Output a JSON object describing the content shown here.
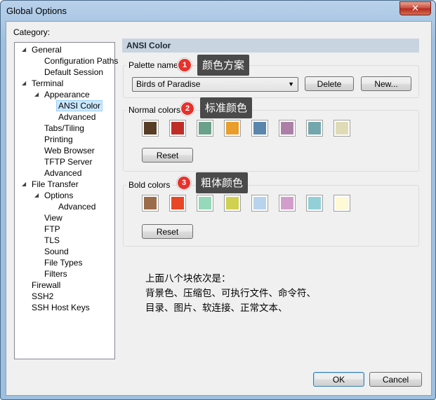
{
  "window": {
    "title": "Global Options",
    "close_glyph": "✕"
  },
  "category_label": "Category:",
  "tree": [
    {
      "label": "General",
      "expanded": true
    },
    {
      "label": "Configuration Paths"
    },
    {
      "label": "Default Session"
    },
    {
      "label": "Terminal",
      "expanded": true
    },
    {
      "label": "Appearance",
      "expanded": true
    },
    {
      "label": "ANSI Color",
      "selected": true
    },
    {
      "label": "Advanced"
    },
    {
      "label": "Tabs/Tiling"
    },
    {
      "label": "Printing"
    },
    {
      "label": "Web Browser"
    },
    {
      "label": "TFTP Server"
    },
    {
      "label": "Advanced"
    },
    {
      "label": "File Transfer",
      "expanded": true
    },
    {
      "label": "Options",
      "expanded": true
    },
    {
      "label": "Advanced"
    },
    {
      "label": "View"
    },
    {
      "label": "FTP"
    },
    {
      "label": "TLS"
    },
    {
      "label": "Sound"
    },
    {
      "label": "File Types"
    },
    {
      "label": "Filters"
    },
    {
      "label": "Firewall"
    },
    {
      "label": "SSH2"
    },
    {
      "label": "SSH Host Keys"
    }
  ],
  "panel": {
    "header": "ANSI Color",
    "palette": {
      "label": "Palette name",
      "selected": "Birds of Paradise",
      "delete_label": "Delete",
      "new_label": "New..."
    },
    "normal": {
      "label": "Normal colors",
      "reset_label": "Reset",
      "colors": [
        "#573d26",
        "#be2d26",
        "#6ba18a",
        "#e99d2a",
        "#5a86ad",
        "#ac80a6",
        "#74a6ad",
        "#e0dbb7"
      ]
    },
    "bold": {
      "label": "Bold colors",
      "reset_label": "Reset",
      "colors": [
        "#9b6c4a",
        "#e84627",
        "#95d8ba",
        "#d0d150",
        "#b8d3ed",
        "#d19ecb",
        "#93cfd7",
        "#fff9d5"
      ]
    }
  },
  "annotations": [
    {
      "num": "1",
      "text": "颜色方案"
    },
    {
      "num": "2",
      "text": "标准颜色"
    },
    {
      "num": "3",
      "text": "粗体颜色"
    }
  ],
  "note": "上面八个块依次是：\n背景色、压缩包、可执行文件、命令符、\n目录、图片、软连接、正常文本、",
  "buttons": {
    "ok": "OK",
    "cancel": "Cancel"
  }
}
